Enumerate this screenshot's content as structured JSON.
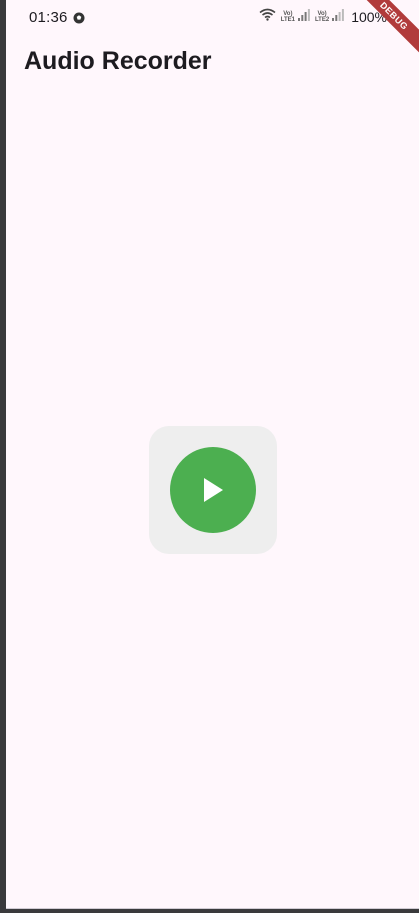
{
  "status_bar": {
    "time": "01:36",
    "sim1_top": "Vo)",
    "sim1_bottom": "LTE1",
    "sim2_top": "Vo)",
    "sim2_bottom": "LTE2",
    "battery": "100%",
    "icons": [
      "soccer-ball-icon",
      "wifi-icon",
      "signal-icon",
      "signal-icon",
      "battery-icon"
    ]
  },
  "debug_banner": "DEBUG",
  "app_bar": {
    "title": "Audio Recorder"
  },
  "player": {
    "button_icon": "play-icon"
  },
  "colors": {
    "background": "#fff7fc",
    "card": "#eeeeee",
    "play_button": "#4caf50",
    "title_text": "#1d1b20",
    "debug_banner": "#b13b3b"
  }
}
